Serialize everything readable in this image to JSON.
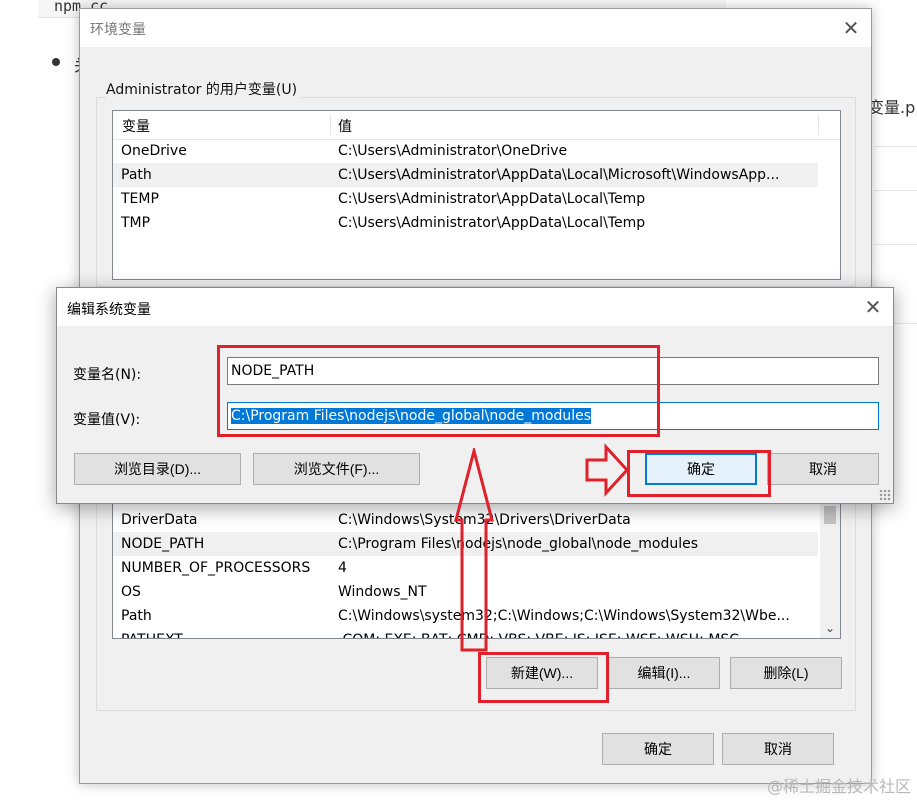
{
  "background": {
    "code_text": "npm cc",
    "bullet_char": "关",
    "right_text": "变量.p"
  },
  "env_window": {
    "title": "环境变量",
    "user_group_label": "Administrator 的用户变量(U)",
    "columns": [
      "变量",
      "值"
    ],
    "user_vars": [
      {
        "name": "OneDrive",
        "value": "C:\\Users\\Administrator\\OneDrive"
      },
      {
        "name": "Path",
        "value": "C:\\Users\\Administrator\\AppData\\Local\\Microsoft\\WindowsApp..."
      },
      {
        "name": "TEMP",
        "value": "C:\\Users\\Administrator\\AppData\\Local\\Temp"
      },
      {
        "name": "TMP",
        "value": "C:\\Users\\Administrator\\AppData\\Local\\Temp"
      }
    ],
    "system_vars": [
      {
        "name": "DriverData",
        "value": "C:\\Windows\\System32\\Drivers\\DriverData"
      },
      {
        "name": "NODE_PATH",
        "value": "C:\\Program Files\\nodejs\\node_global\\node_modules"
      },
      {
        "name": "NUMBER_OF_PROCESSORS",
        "value": "4"
      },
      {
        "name": "OS",
        "value": "Windows_NT"
      },
      {
        "name": "Path",
        "value": "C:\\Windows\\system32;C:\\Windows;C:\\Windows\\System32\\Wbe..."
      },
      {
        "name": "PATHEXT",
        "value": ".COM;.EXE;.BAT;.CMD;.VBS;.VBE;.JS;.JSE;.WSF;.WSH;.MSC"
      }
    ],
    "sys_buttons": {
      "new": "新建(W)...",
      "edit": "编辑(I)...",
      "delete": "删除(L)"
    },
    "ok": "确定",
    "cancel": "取消"
  },
  "edit_dialog": {
    "title": "编辑系统变量",
    "name_label": "变量名(N):",
    "name_value": "NODE_PATH",
    "value_label": "变量值(V):",
    "value_value": "C:\\Program Files\\nodejs\\node_global\\node_modules",
    "browse_dir": "浏览目录(D)...",
    "browse_file": "浏览文件(F)...",
    "ok": "确定",
    "cancel": "取消"
  },
  "icons": {
    "close": "close-icon",
    "arrow_right": "arrow-right-annotation",
    "arrow_up": "arrow-up-annotation"
  },
  "colors": {
    "annotation": "#e0202a",
    "selection": "#0078d7"
  },
  "watermark": "@稀土掘金技术社区"
}
